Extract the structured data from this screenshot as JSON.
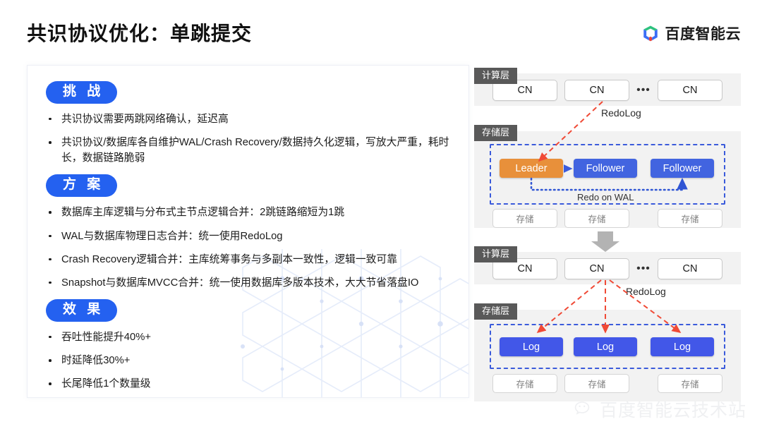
{
  "header": {
    "title": "共识协议优化：单跳提交",
    "brand": "百度智能云",
    "logo_icon": "baidu-cloud-cube-logo",
    "logo_colors": {
      "green": "#2EC27E",
      "blue": "#3B6EF6",
      "red": "#E8453C"
    }
  },
  "left_panel": {
    "sections": [
      {
        "badge": "挑 战",
        "bullets": [
          "共识协议需要两跳网络确认，延迟高",
          "共识协议/数据库各自维护WAL/Crash Recovery/数据持久化逻辑，写放大严重，耗时长，数据链路脆弱"
        ]
      },
      {
        "badge": "方 案",
        "bullets": [
          "数据库主库逻辑与分布式主节点逻辑合并：2跳链路缩短为1跳",
          "WAL与数据库物理日志合并：统一使用RedoLog",
          "Crash Recovery逻辑合并：主库统筹事务与多副本一致性，逻辑一致可靠",
          "Snapshot与数据库MVCC合并：统一使用数据库多版本技术，大大节省落盘IO"
        ]
      },
      {
        "badge": "效 果",
        "bullets": [
          "吞吐性能提升40%+",
          "时延降低30%+",
          "长尾降低1个数量级"
        ]
      }
    ],
    "watermark_icon": "hexagon-pattern-watermark"
  },
  "right_panel": {
    "diagram_before": {
      "compute_layer_tag": "计算层",
      "compute_nodes": [
        "CN",
        "CN",
        "CN"
      ],
      "compute_ellipsis": "•••",
      "redolog_label": "RedoLog",
      "storage_layer_tag": "存储层",
      "roles": [
        "Leader",
        "Follower",
        "Follower"
      ],
      "role_colors": {
        "leader": "#e8903a",
        "follower": "#4264e0"
      },
      "group_label": "Redo on WAL",
      "storage_nodes": [
        "存储",
        "存储",
        "存储"
      ]
    },
    "transition_icon": "down-arrow-icon",
    "diagram_after": {
      "compute_layer_tag": "计算层",
      "compute_nodes": [
        "CN",
        "CN",
        "CN"
      ],
      "compute_ellipsis": "•••",
      "redolog_label": "RedoLog",
      "storage_layer_tag": "存储层",
      "logs": [
        "Log",
        "Log",
        "Log"
      ],
      "log_color": "#4257e8",
      "storage_nodes": [
        "存储",
        "存储",
        "存储"
      ]
    }
  },
  "footer": {
    "watermark_text": "百度智能云技术站",
    "watermark_icon": "wechat-icon"
  }
}
